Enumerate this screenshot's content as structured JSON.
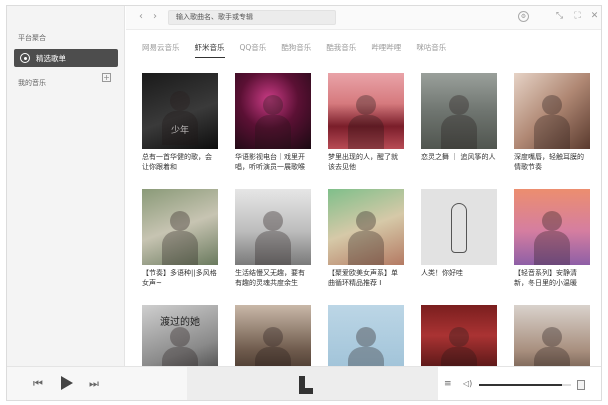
{
  "sidebar": {
    "heading": "平台聚合",
    "active_item": "精选歌单",
    "my_music": "我的音乐",
    "add_symbol": "+"
  },
  "topbar": {
    "back": "‹",
    "forward": "›",
    "search_text": "输入歌曲名、歌手或专辑"
  },
  "tabs": [
    {
      "label": "网易云音乐",
      "active": false
    },
    {
      "label": "虾米音乐",
      "active": true
    },
    {
      "label": "QQ音乐",
      "active": false
    },
    {
      "label": "酷狗音乐",
      "active": false
    },
    {
      "label": "酷我音乐",
      "active": false
    },
    {
      "label": "哔哩哔哩",
      "active": false
    },
    {
      "label": "咪咕音乐",
      "active": false
    }
  ],
  "playlists": [
    {
      "title": "总有一首华健的歌，会让你跟着和",
      "cover_text": "少年"
    },
    {
      "title": "华语影视电台｜戏里开唱，听听演员一展歌喉",
      "cover_text": ""
    },
    {
      "title": "梦里出现的人，醒了就该去见他",
      "cover_text": ""
    },
    {
      "title": "恋灵之舞 ｜ 追风筝的人",
      "cover_text": ""
    },
    {
      "title": "深度嘴唇，轻触耳膜的情歌节奏",
      "cover_text": ""
    },
    {
      "title": "【节奏】多语种||多风格女声~",
      "cover_text": ""
    },
    {
      "title": "生活结慢又无趣，要有有趣的灵魂共度余生",
      "cover_text": ""
    },
    {
      "title": "【聚爱欧美女声系】单曲循环精品推荐 I",
      "cover_text": ""
    },
    {
      "title": "人类！你好哇",
      "cover_text": ""
    },
    {
      "title": "【轻音系列】安静清新，冬日里的小温暖",
      "cover_text": ""
    },
    {
      "title": "",
      "cover_text": "渡过的她"
    },
    {
      "title": "",
      "cover_text": ""
    },
    {
      "title": "",
      "cover_text": ""
    },
    {
      "title": "",
      "cover_text": ""
    },
    {
      "title": "",
      "cover_text": ""
    }
  ],
  "player": {
    "prev_icon": "⏮",
    "next_icon": "⏭",
    "playlist_icon": "≡",
    "volume_icon": "🔈",
    "volume_level": 0.9
  },
  "colors": {
    "sidebar_active_bg": "#4d4d4d",
    "tab_active": "#333333",
    "tab_inactive": "#9a9a9a"
  }
}
